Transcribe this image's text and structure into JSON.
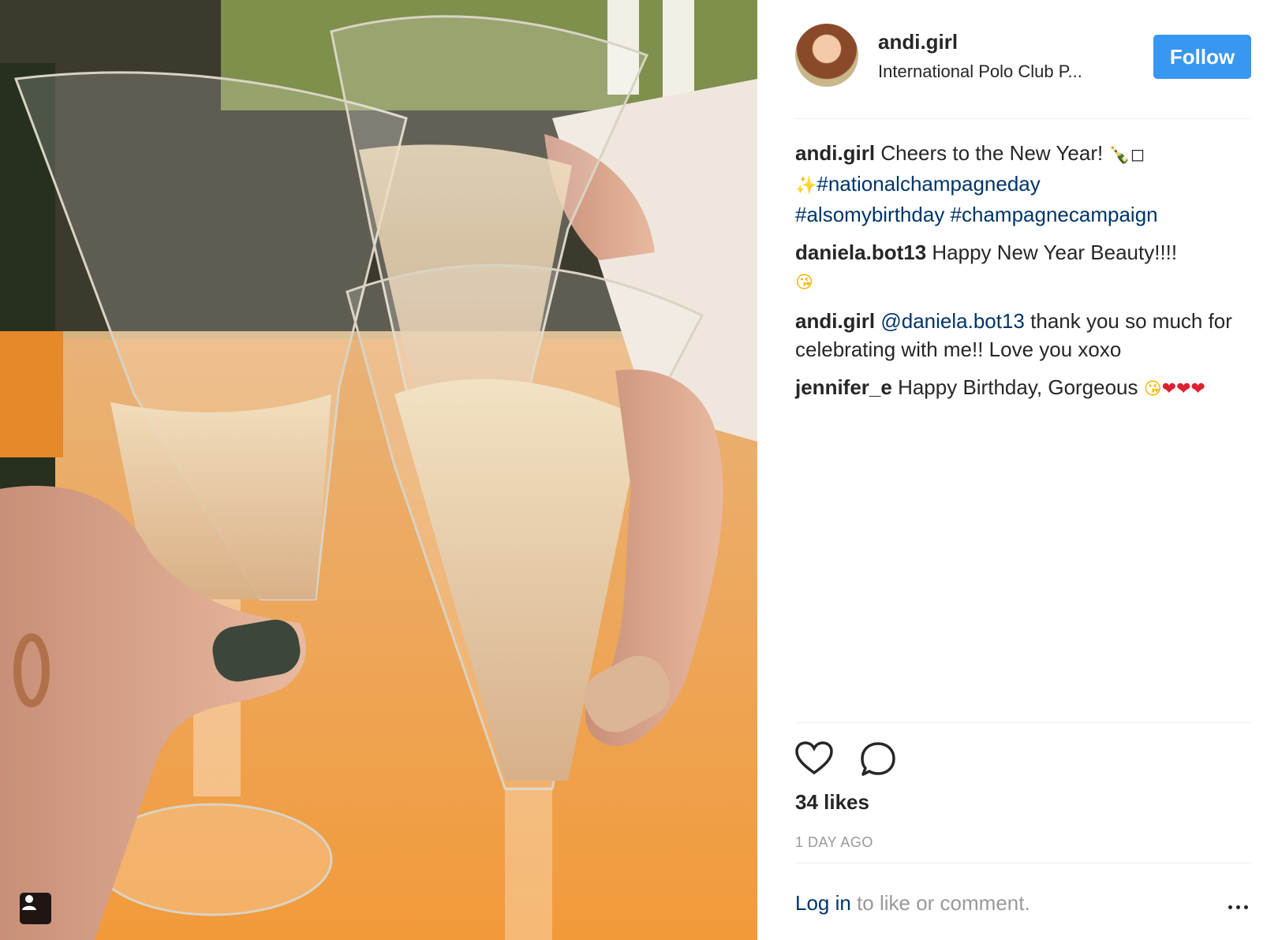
{
  "post": {
    "username": "andi.girl",
    "location": "International Polo Club P...",
    "follow_label": "Follow"
  },
  "comments": [
    {
      "user": "andi.girl",
      "text": "Cheers to the New Year! ",
      "emojis": "🍾◻",
      "line2_emoji": "✨",
      "hashtags": [
        "#nationalchampagneday",
        "#alsomybirthday",
        "#champagnecampaign"
      ]
    },
    {
      "user": "daniela.bot13",
      "text": "Happy New Year Beauty!!!! ",
      "emojis": "😘"
    },
    {
      "user": "andi.girl",
      "mention": "@daniela.bot13",
      "text": " thank you so much for celebrating with me!! Love you xoxo"
    },
    {
      "user": "jennifer_e",
      "text": "Happy Birthday, Gorgeous ",
      "emojis_kiss": "😘",
      "emojis_hearts": "❤❤❤"
    }
  ],
  "actions": {
    "like_icon": "heart-icon",
    "comment_icon": "comment-icon"
  },
  "likes": "34 likes",
  "timestamp": "1 DAY AGO",
  "footer": {
    "login_link": "Log in",
    "login_text": " to like or comment."
  },
  "colors": {
    "follow_button": "#3897f0",
    "hashtag": "#003569",
    "muted": "#999999"
  }
}
